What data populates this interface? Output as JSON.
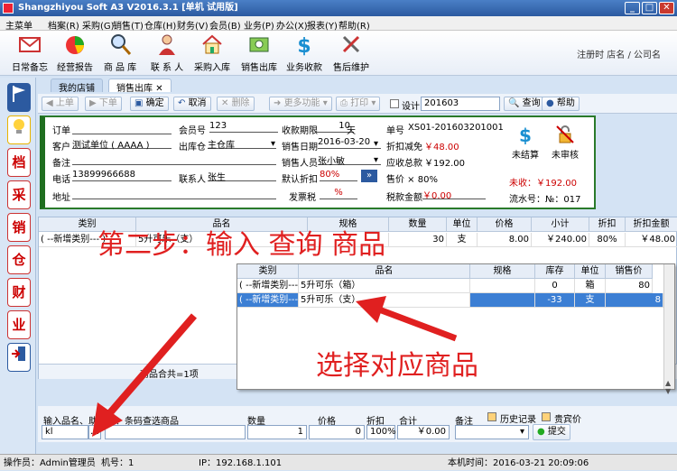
{
  "window": {
    "title": "Shangzhiyou Soft A3 V2016.3.1 [单机 试用版]"
  },
  "menu": [
    "主菜单",
    "档案(R)",
    "采购(G)",
    "销售(T)",
    "仓库(H)",
    "财务(V)",
    "会员(B)",
    "业务(P)",
    "办公(X)",
    "报表(Y)",
    "帮助(R)"
  ],
  "toolbar": [
    {
      "label": "日常备忘",
      "icon": "mail-icon"
    },
    {
      "label": "经营报告",
      "icon": "pie-chart-icon"
    },
    {
      "label": "商 品 库",
      "icon": "magnifier-icon"
    },
    {
      "label": "联 系 人",
      "icon": "person-icon"
    },
    {
      "label": "采购入库",
      "icon": "house-icon"
    },
    {
      "label": "销售出库",
      "icon": "money-icon"
    },
    {
      "label": "业务收款",
      "icon": "dollar-icon"
    },
    {
      "label": "售后维护",
      "icon": "tools-icon"
    }
  ],
  "registration": "注册时 店名 / 公司名",
  "sidebar": [
    "档",
    "采",
    "销",
    "仓",
    "财",
    "业"
  ],
  "tabs": [
    {
      "label": "我的店铺"
    },
    {
      "label": "销售出库",
      "close": "✕"
    }
  ],
  "actions": {
    "prev": "上单",
    "next": "下单",
    "confirm": "确定",
    "cancel": "取消",
    "delete": "删除",
    "more": "更多功能",
    "print": "打印",
    "design": "设计",
    "doc_no": "201603",
    "query": "查询",
    "help": "帮助"
  },
  "header": {
    "order_label": "订单",
    "member_no_label": "会员号",
    "member_no": "123",
    "pay_term_label": "收款期限",
    "pay_term": "10",
    "pay_term_unit": "天",
    "doc_no_label": "单号",
    "doc_no": "XS01-201603201001",
    "customer_label": "客户",
    "customer": "测试单位 ( AAAA )",
    "warehouse_label": "出库仓",
    "warehouse": "主仓库",
    "sale_date_label": "销售日期",
    "sale_date": "2016-03-20",
    "discount_label": "折扣减免",
    "discount": "￥48.00",
    "note_label": "备注",
    "salesman_label": "销售人员",
    "salesman": "张小敏",
    "receivable_label": "应收总款",
    "receivable": "￥192.00",
    "phone_label": "电话",
    "phone": "13899966688",
    "contact_label": "联系人",
    "contact": "张生",
    "default_discount_label": "默认折扣",
    "default_discount": "80%",
    "price_label": "售价 × 80%",
    "address_label": "地址",
    "invoice_tax_label": "发票税",
    "invoice_tax": "%",
    "tax_amount_label": "税款金额",
    "tax_amount": "￥0.00",
    "unsettled_label": "未结算",
    "unchecked_label": "未审核",
    "uncollected": "未收：￥192.00",
    "serial": "流水号：№：017"
  },
  "grid": {
    "headers": [
      "类别",
      "品名",
      "规格",
      "数量",
      "单位",
      "价格",
      "小计",
      "折扣",
      "折扣金额"
    ],
    "row": {
      "category": "( --新增类别--- )",
      "name": "5升可乐（支）",
      "spec": "",
      "qty": "30",
      "unit": "支",
      "price": "8.00",
      "subtotal": "￥240.00",
      "discount": "80%",
      "discount_amount": "￥48.00"
    },
    "footer": "商品合共=1项"
  },
  "popup": {
    "headers": [
      "类别",
      "品名",
      "规格",
      "库存",
      "单位",
      "销售价"
    ],
    "rows": [
      {
        "category": "( --新增类别---",
        "name": "5升可乐（箱）",
        "spec": "",
        "stock": "0",
        "unit": "箱",
        "price": "80"
      },
      {
        "category": "( --新增类别---",
        "name": "5升可乐（支）",
        "spec": "",
        "stock": "-33",
        "unit": "支",
        "price": "8"
      }
    ]
  },
  "bottom": {
    "search_label": "输入品名、助记码、条码查选商品",
    "search_value": "kl",
    "qty_label": "数量",
    "qty": "1",
    "price_label": "价格",
    "price": "0",
    "discount_label": "折扣",
    "discount": "100%",
    "total_label": "合计",
    "total": "￥0.00",
    "note_label": "备注",
    "history_label": "历史记录",
    "vip_label": "贵宾价",
    "submit": "提交"
  },
  "status": {
    "operator": "操作员：Admin管理员",
    "machine": "机号：1",
    "ip": "IP：192.168.1.101",
    "time": "本机时间：2016-03-21 20:09:06"
  },
  "annotations": {
    "step2": "第二步：输入 查询 商品",
    "select": "选择对应商品"
  },
  "colors": {
    "accent": "#2c5aa0",
    "panel_border": "#2a7a2a",
    "annotation": "#e02020",
    "selection": "#3c7fd4"
  }
}
